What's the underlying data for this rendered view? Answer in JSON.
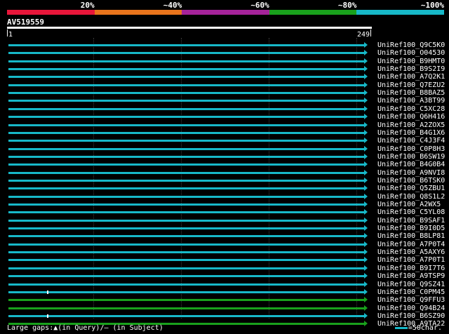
{
  "legend": [
    {
      "label": "20%",
      "color": "#e8163a"
    },
    {
      "label": "~40%",
      "color": "#e8741c"
    },
    {
      "label": "~60%",
      "color": "#a5239a"
    },
    {
      "label": "~80%",
      "color": "#19a11c"
    },
    {
      "label": "~100%",
      "color": "#17b8c8"
    }
  ],
  "query": {
    "name": "AV519559",
    "start": "1",
    "end": "249"
  },
  "hits": [
    {
      "label": "UniRef100_Q9C5K0",
      "color": "#17b8c8",
      "gap": false
    },
    {
      "label": "UniRef100_O04530",
      "color": "#17b8c8",
      "gap": false
    },
    {
      "label": "UniRef100_B9HMT0",
      "color": "#17b8c8",
      "gap": false
    },
    {
      "label": "UniRef100_B9S2I9",
      "color": "#17b8c8",
      "gap": false
    },
    {
      "label": "UniRef100_A7Q2K1",
      "color": "#17b8c8",
      "gap": false
    },
    {
      "label": "UniRef100_Q7EZU2",
      "color": "#17b8c8",
      "gap": false
    },
    {
      "label": "UniRef100_B8BAZ5",
      "color": "#17b8c8",
      "gap": false
    },
    {
      "label": "UniRef100_A3BT99",
      "color": "#17b8c8",
      "gap": false
    },
    {
      "label": "UniRef100_C5XC28",
      "color": "#17b8c8",
      "gap": false
    },
    {
      "label": "UniRef100_Q6H416",
      "color": "#17b8c8",
      "gap": false
    },
    {
      "label": "UniRef100_A2ZOX5",
      "color": "#17b8c8",
      "gap": false
    },
    {
      "label": "UniRef100_B4G1X6",
      "color": "#17b8c8",
      "gap": false
    },
    {
      "label": "UniRef100_C4J3F4",
      "color": "#17b8c8",
      "gap": false
    },
    {
      "label": "UniRef100_C0P8H3",
      "color": "#17b8c8",
      "gap": false
    },
    {
      "label": "UniRef100_B6SW19",
      "color": "#17b8c8",
      "gap": false
    },
    {
      "label": "UniRef100_B4G0B4",
      "color": "#17b8c8",
      "gap": false
    },
    {
      "label": "UniRef100_A9NVI8",
      "color": "#17b8c8",
      "gap": false
    },
    {
      "label": "UniRef100_B6TSK0",
      "color": "#17b8c8",
      "gap": false
    },
    {
      "label": "UniRef100_Q5ZBU1",
      "color": "#17b8c8",
      "gap": false
    },
    {
      "label": "UniRef100_Q8S1L2",
      "color": "#17b8c8",
      "gap": false
    },
    {
      "label": "UniRef100_A2WX5",
      "color": "#17b8c8",
      "gap": false
    },
    {
      "label": "UniRef100_C5YL08",
      "color": "#17b8c8",
      "gap": false
    },
    {
      "label": "UniRef100_B9SAF1",
      "color": "#17b8c8",
      "gap": false
    },
    {
      "label": "UniRef100_B9I0D5",
      "color": "#17b8c8",
      "gap": false
    },
    {
      "label": "UniRef100_B8LP81",
      "color": "#17b8c8",
      "gap": false
    },
    {
      "label": "UniRef100_A7P0T4",
      "color": "#17b8c8",
      "gap": false
    },
    {
      "label": "UniRef100_A5AXY6",
      "color": "#17b8c8",
      "gap": false
    },
    {
      "label": "UniRef100_A7P0T1",
      "color": "#17b8c8",
      "gap": false
    },
    {
      "label": "UniRef100_B9I7T6",
      "color": "#17b8c8",
      "gap": false
    },
    {
      "label": "UniRef100_A9TSP9",
      "color": "#17b8c8",
      "gap": false
    },
    {
      "label": "UniRef100_Q9SZ41",
      "color": "#17b8c8",
      "gap": false
    },
    {
      "label": "UniRef100_C0PM45",
      "color": "#17b8c8",
      "gap": true
    },
    {
      "label": "UniRef100_Q9FFU3",
      "color": "#19a11c",
      "gap": false
    },
    {
      "label": "UniRef100_Q94B24",
      "color": "#19a11c",
      "gap": false
    },
    {
      "label": "UniRef100_B6SZ90",
      "color": "#17b8c8",
      "gap": true
    },
    {
      "label": "UniRef100_A9TA22",
      "color": "#19a11c",
      "gap": false
    }
  ],
  "footer": {
    "gaps_text": "Large gaps:▲(in Query)/– (in Subject)",
    "scale_text": "=50char."
  }
}
